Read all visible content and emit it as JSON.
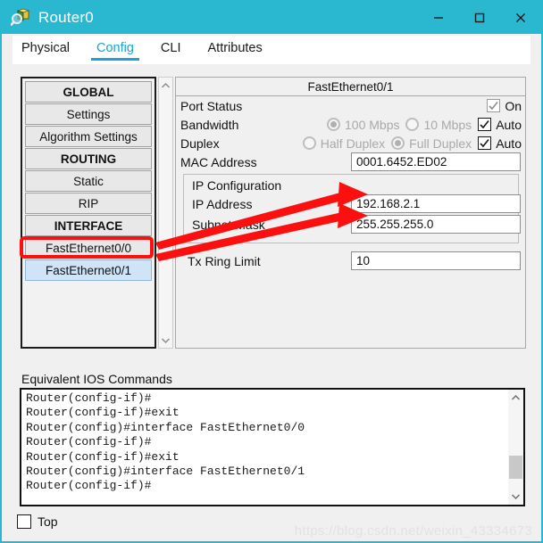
{
  "window": {
    "title": "Router0",
    "icon": "router-magnifier-icon",
    "accent_color": "#29b8d0",
    "minimize_label": "—",
    "maximize_label": "□",
    "close_label": "✕"
  },
  "tabs": [
    {
      "label": "Physical",
      "active": false
    },
    {
      "label": "Config",
      "active": true
    },
    {
      "label": "CLI",
      "active": false
    },
    {
      "label": "Attributes",
      "active": false
    }
  ],
  "sidebar": {
    "items": [
      {
        "label": "GLOBAL",
        "type": "header",
        "selected": false
      },
      {
        "label": "Settings",
        "type": "item",
        "selected": false
      },
      {
        "label": "Algorithm Settings",
        "type": "item",
        "selected": false
      },
      {
        "label": "ROUTING",
        "type": "header",
        "selected": false
      },
      {
        "label": "Static",
        "type": "item",
        "selected": false
      },
      {
        "label": "RIP",
        "type": "item",
        "selected": false
      },
      {
        "label": "INTERFACE",
        "type": "header",
        "selected": false
      },
      {
        "label": "FastEthernet0/0",
        "type": "item",
        "selected": false
      },
      {
        "label": "FastEthernet0/1",
        "type": "item",
        "selected": true
      }
    ],
    "scroll_up_icon": "chevron-up-icon",
    "scroll_down_icon": "chevron-down-icon"
  },
  "config": {
    "panel_title": "FastEthernet0/1",
    "port_status": {
      "label": "Port Status",
      "checkbox_label": "On",
      "checked": true
    },
    "bandwidth": {
      "label": "Bandwidth",
      "option_100": "100 Mbps",
      "option_10": "10 Mbps",
      "selected": "100 Mbps",
      "auto_label": "Auto",
      "auto_checked": true
    },
    "duplex": {
      "label": "Duplex",
      "option_half": "Half Duplex",
      "option_full": "Full Duplex",
      "selected": "Full Duplex",
      "auto_label": "Auto",
      "auto_checked": true
    },
    "mac": {
      "label": "MAC Address",
      "value": "0001.6452.ED02"
    },
    "ip_configuration": {
      "group_label": "IP Configuration",
      "ip_address_label": "IP Address",
      "ip_address_value": "192.168.2.1",
      "subnet_mask_label": "Subnet Mask",
      "subnet_mask_value": "255.255.255.0"
    },
    "tx_ring_limit": {
      "label": "Tx Ring Limit",
      "value": "10"
    }
  },
  "console": {
    "label": "Equivalent IOS Commands",
    "lines": [
      "Router(config-if)#",
      "Router(config-if)#exit",
      "Router(config)#interface FastEthernet0/0",
      "Router(config-if)#",
      "Router(config-if)#exit",
      "Router(config)#interface FastEthernet0/1",
      "Router(config-if)#"
    ],
    "scroll_up_icon": "chevron-up-icon",
    "scroll_down_icon": "chevron-down-icon"
  },
  "footer": {
    "top_label": "Top",
    "top_checked": false
  },
  "annotations": {
    "color": "#fb0f0f",
    "highlight_target": "FastEthernet0/1",
    "arrow_targets": [
      "IP Address",
      "Subnet Mask"
    ]
  },
  "watermark": {
    "text": "https://blog.csdn.net/weixin_43334673"
  }
}
